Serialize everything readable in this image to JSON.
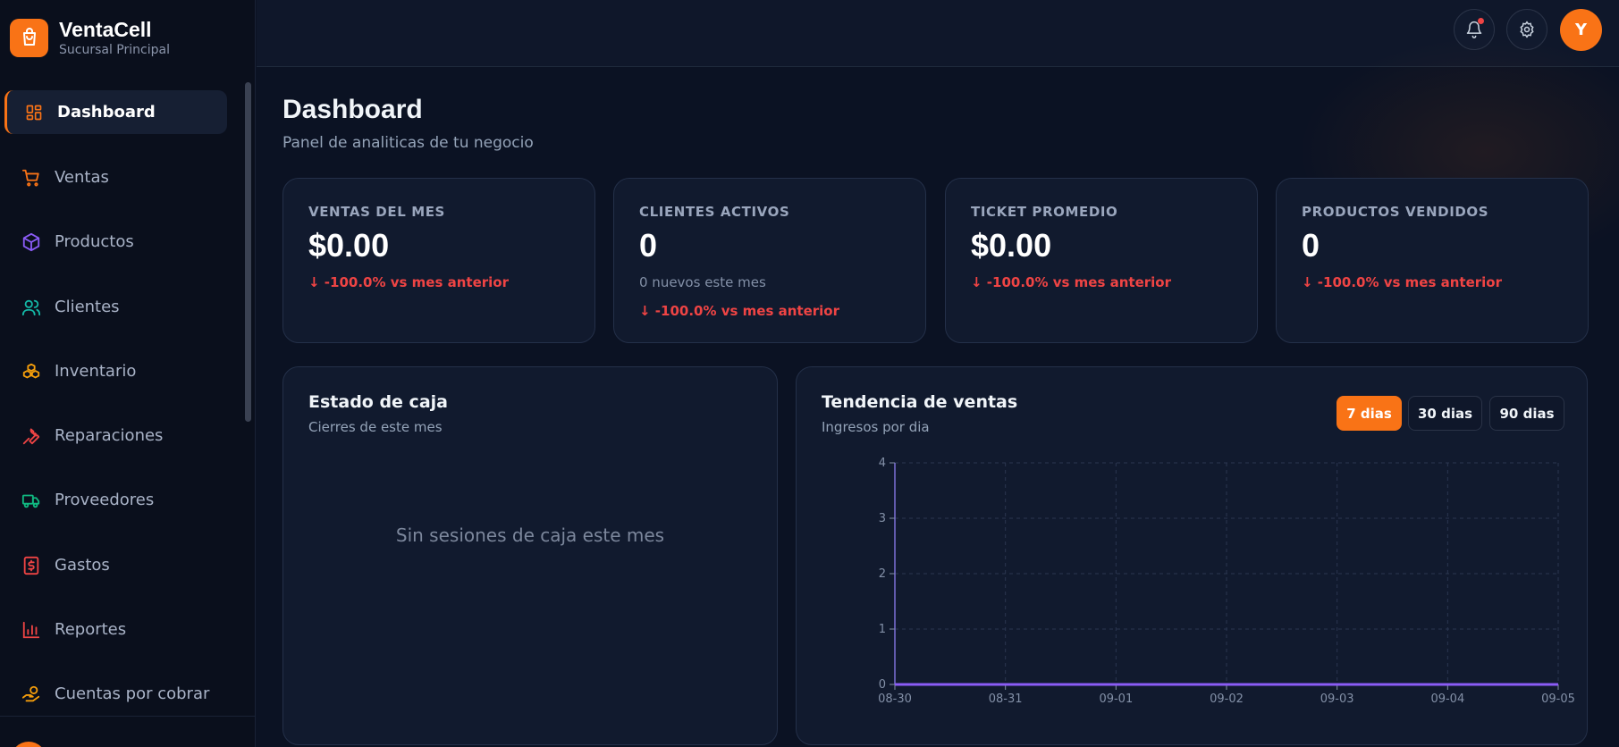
{
  "brand": {
    "name": "VentaCell",
    "subtitle": "Sucursal Principal"
  },
  "sidebar": {
    "items": [
      {
        "label": "Dashboard",
        "icon": "dashboard-grid-icon",
        "color": "#f97316",
        "active": true
      },
      {
        "label": "Ventas",
        "icon": "cart-icon",
        "color": "#f97316"
      },
      {
        "label": "Productos",
        "icon": "box-icon",
        "color": "#8b5cf6"
      },
      {
        "label": "Clientes",
        "icon": "users-icon",
        "color": "#14b8a6"
      },
      {
        "label": "Inventario",
        "icon": "boxes-icon",
        "color": "#f59e0b"
      },
      {
        "label": "Reparaciones",
        "icon": "wrench-icon",
        "color": "#ef4444"
      },
      {
        "label": "Proveedores",
        "icon": "truck-icon",
        "color": "#10b981"
      },
      {
        "label": "Gastos",
        "icon": "receipt-dollar-icon",
        "color": "#ef4444"
      },
      {
        "label": "Reportes",
        "icon": "bar-chart-icon",
        "color": "#ef4444"
      },
      {
        "label": "Cuentas por cobrar",
        "icon": "hand-coins-icon",
        "color": "#f59e0b"
      }
    ]
  },
  "header": {
    "avatar_initial": "Y",
    "has_notification": true
  },
  "page": {
    "title": "Dashboard",
    "subtitle": "Panel de analiticas de tu negocio"
  },
  "kpis": [
    {
      "label": "VENTAS DEL MES",
      "value": "$0.00",
      "sub": "",
      "delta": "-100.0% vs mes anterior"
    },
    {
      "label": "CLIENTES ACTIVOS",
      "value": "0",
      "sub": "0 nuevos este mes",
      "delta": "-100.0% vs mes anterior"
    },
    {
      "label": "TICKET PROMEDIO",
      "value": "$0.00",
      "sub": "",
      "delta": "-100.0% vs mes anterior"
    },
    {
      "label": "PRODUCTOS VENDIDOS",
      "value": "0",
      "sub": "",
      "delta": "-100.0% vs mes anterior"
    }
  ],
  "cash": {
    "title": "Estado de caja",
    "subtitle": "Cierres de este mes",
    "empty": "Sin sesiones de caja este mes"
  },
  "sales": {
    "title": "Tendencia de ventas",
    "subtitle": "Ingresos por dia",
    "ranges": [
      "7 dias",
      "30 dias",
      "90 dias"
    ],
    "active_range": 0
  },
  "colors": {
    "accent": "#f97316",
    "negative": "#ef4444",
    "line": "#8b5cf6"
  },
  "chart_data": {
    "type": "line",
    "x": [
      "08-30",
      "08-31",
      "09-01",
      "09-02",
      "09-03",
      "09-04",
      "09-05"
    ],
    "series": [
      {
        "values": [
          0,
          0,
          0,
          0,
          0,
          0,
          0
        ]
      }
    ],
    "ylim": [
      0,
      4
    ],
    "yticks": [
      0,
      1,
      2,
      3,
      4
    ],
    "grid": true,
    "title": "",
    "xlabel": "",
    "ylabel": ""
  }
}
